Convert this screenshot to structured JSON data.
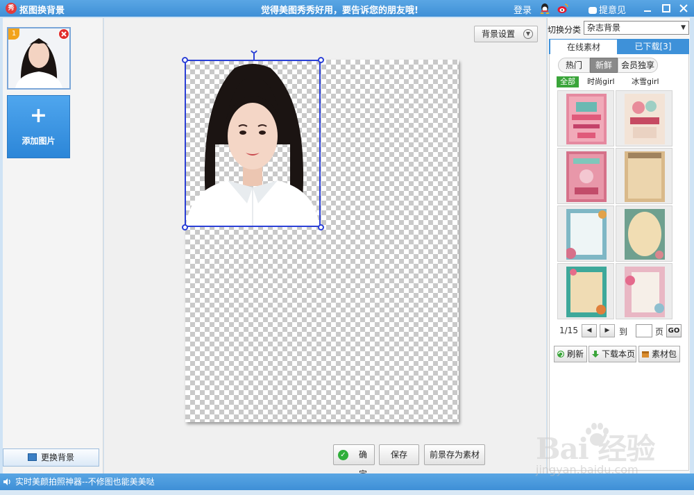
{
  "window": {
    "app_title": "抠图换背景",
    "logo_text": "秀",
    "slogan": "觉得美图秀秀好用，要告诉您的朋友哦!",
    "login": "登录",
    "feedback": "提意见",
    "controls": [
      "minimize-icon",
      "maximize-icon",
      "close-icon"
    ]
  },
  "left": {
    "thumb_badge": "1",
    "add_image_plus": "+",
    "add_image_label": "添加图片",
    "change_bg_label": "更换背景"
  },
  "canvas": {
    "bg_settings_label": "背景设置"
  },
  "buttons": {
    "confirm": "确定",
    "save": "保存",
    "save_as_material": "前景存为素材"
  },
  "right": {
    "category_label": "切换分类",
    "category_value": "杂志背景",
    "tabs": [
      {
        "label": "在线素材",
        "active": true
      },
      {
        "label": "已下载[3]",
        "active": false
      }
    ],
    "subtabs": [
      {
        "label": "热门",
        "active": false
      },
      {
        "label": "新鲜",
        "active": true
      },
      {
        "label": "会员独享",
        "active": false
      }
    ],
    "filters": [
      {
        "label": "全部",
        "active": true
      },
      {
        "label": "时尚girl",
        "active": false
      },
      {
        "label": "冰雪girl",
        "active": false
      }
    ],
    "materials": [
      {
        "name": "ice-cream-pink"
      },
      {
        "name": "ice-cream-vintage"
      },
      {
        "name": "delicious-pink"
      },
      {
        "name": "vintage-paper"
      },
      {
        "name": "floral-blue-frame"
      },
      {
        "name": "oval-floral-frame"
      },
      {
        "name": "teal-floral-frame"
      },
      {
        "name": "pink-floral-frame"
      }
    ],
    "pager": {
      "current": "1/15",
      "to_label": "到",
      "page_label": "页",
      "go": "GO"
    },
    "actions": {
      "refresh": "刷新",
      "download_page": "下载本页",
      "material_pack": "素材包"
    }
  },
  "status": {
    "text": "实时美颜拍照神器--不修图也能美美哒"
  },
  "watermark": {
    "brand": "Bai  经验",
    "url": "jingyan.baidu.com"
  },
  "colors": {
    "title_bar": "#3e8fd6",
    "accent_blue": "#2c86d8",
    "selection": "#2a3fd6",
    "active_filter": "#3aa53a"
  }
}
